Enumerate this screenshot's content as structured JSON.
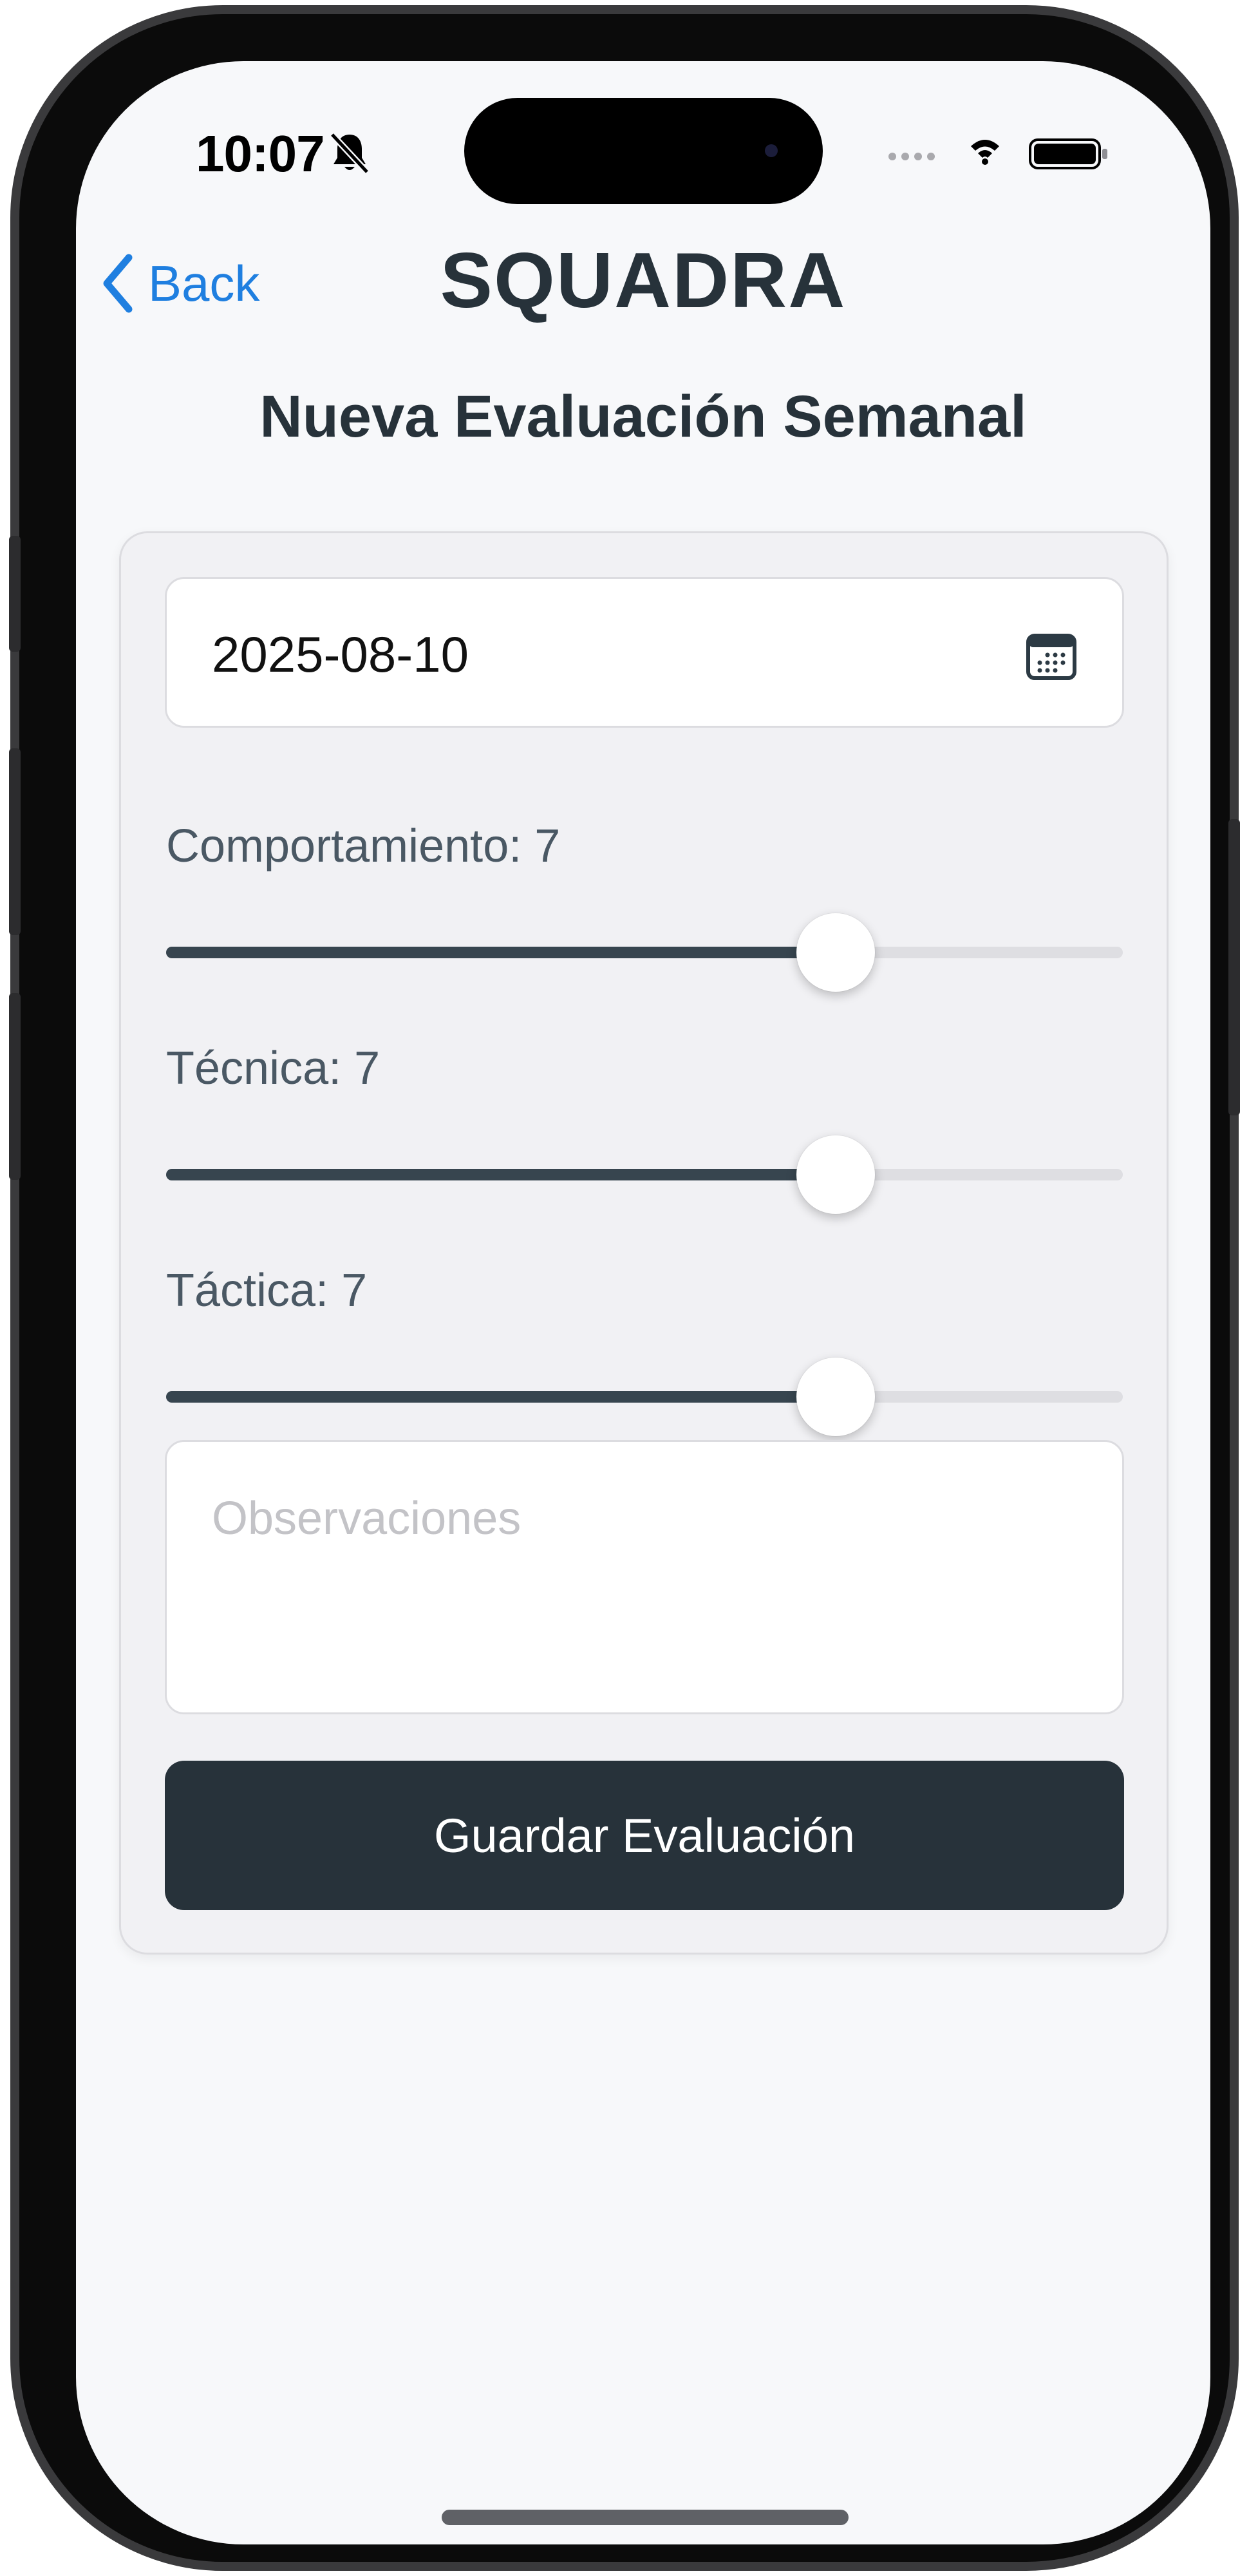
{
  "status_bar": {
    "time": "10:07",
    "icons": [
      "bell-slash-icon",
      "cellular-icon",
      "wifi-icon",
      "battery-icon"
    ]
  },
  "nav": {
    "back_label": "Back",
    "back_icon": "chevron-left-icon",
    "app_title": "SQUADRA"
  },
  "page": {
    "title": "Nueva Evaluación Semanal"
  },
  "form": {
    "date": {
      "value": "2025-08-10",
      "icon": "calendar-icon"
    },
    "sliders": [
      {
        "label": "Comportamiento: 7",
        "value": 7,
        "min": 0,
        "max": 10
      },
      {
        "label": "Técnica: 7",
        "value": 7,
        "min": 0,
        "max": 10
      },
      {
        "label": "Táctica: 7",
        "value": 7,
        "min": 0,
        "max": 10
      }
    ],
    "notes": {
      "placeholder": "Observaciones",
      "value": ""
    },
    "submit_label": "Guardar Evaluación"
  },
  "colors": {
    "accent": "#1f7fe0",
    "primary_dark": "#27323a",
    "slider_fill": "#37454f",
    "track": "#dedee2",
    "background": "#f7f8fa",
    "card": "#f1f1f4"
  }
}
